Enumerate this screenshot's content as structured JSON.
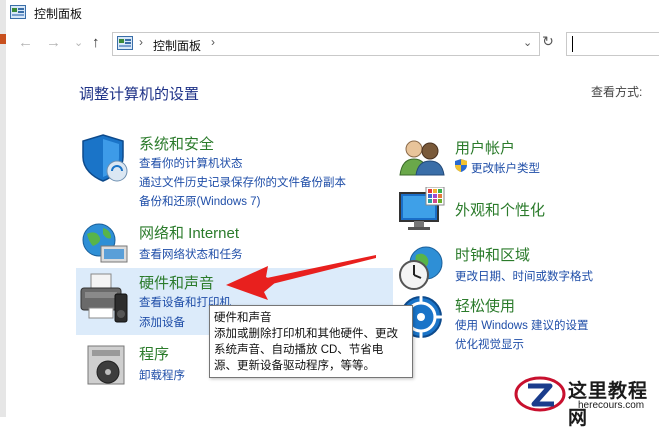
{
  "window": {
    "title": "控制面板",
    "icon": "control-panel-icon"
  },
  "nav": {
    "back_icon": "←",
    "forward_icon": "→",
    "recent_icon": "⌄",
    "up_icon": "↑",
    "address": {
      "separator": "›",
      "crumb": "控制面板",
      "crumb_sep": "›",
      "dropdown": "⌄"
    },
    "refresh": "↻"
  },
  "main": {
    "heading": "调整计算机的设置",
    "view_by": "查看方式:"
  },
  "categories": {
    "system": {
      "title": "系统和安全",
      "links": [
        "查看你的计算机状态",
        "通过文件历史记录保存你的文件备份副本",
        "备份和还原(Windows 7)"
      ],
      "icon": "shield-icon"
    },
    "network": {
      "title": "网络和 Internet",
      "links": [
        "查看网络状态和任务"
      ],
      "icon": "globe-network-icon"
    },
    "hardware": {
      "title": "硬件和声音",
      "links": [
        "查看设备和打印机",
        "添加设备"
      ],
      "icon": "printer-speaker-icon"
    },
    "programs": {
      "title": "程序",
      "links": [
        "卸载程序"
      ],
      "icon": "programs-disc-icon"
    },
    "users": {
      "title": "用户帐户",
      "links": [
        "更改帐户类型"
      ],
      "icon": "users-icon"
    },
    "appearance": {
      "title": "外观和个性化",
      "links": [],
      "icon": "monitor-palette-icon"
    },
    "clock": {
      "title": "时钟和区域",
      "links": [
        "更改日期、时间或数字格式"
      ],
      "icon": "clock-globe-icon"
    },
    "ease": {
      "title": "轻松使用",
      "links": [
        "使用 Windows 建议的设置",
        "优化视觉显示"
      ],
      "icon": "ease-of-access-icon"
    }
  },
  "tooltip": {
    "lines": [
      "硬件和声音",
      "添加或删除打印机和其他硬件、更改",
      "系统声音、自动播放 CD、节省电",
      "源、更新设备驱动程序，等等。"
    ]
  },
  "watermark": {
    "title": "这里教程网",
    "sub": "herecours.com"
  },
  "colors": {
    "category_title": "#2b7b2b",
    "link": "#1f4ea8",
    "heading": "#1e3287",
    "highlight": "#dcebfa",
    "arrow": "#e8201e"
  }
}
